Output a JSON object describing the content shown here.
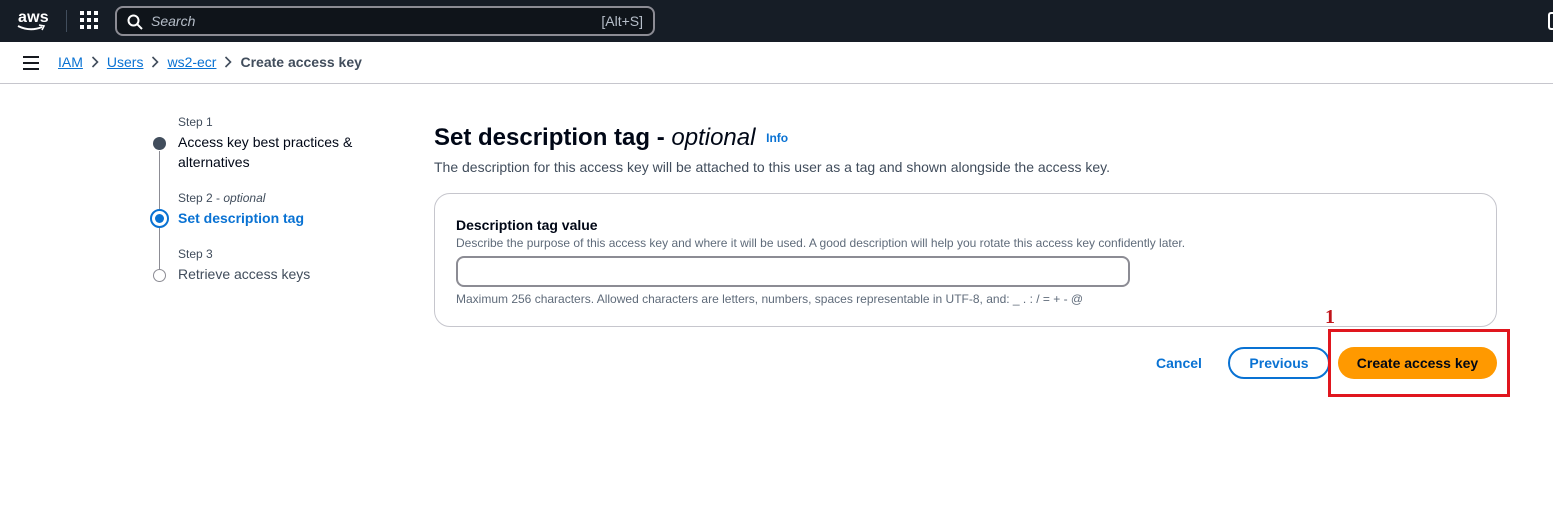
{
  "topnav": {
    "logo_text": "aws",
    "search_placeholder": "Search",
    "search_shortcut": "[Alt+S]"
  },
  "breadcrumb": {
    "items": [
      "IAM",
      "Users",
      "ws2-ecr"
    ],
    "current": "Create access key"
  },
  "steps": [
    {
      "number": "Step 1",
      "optional": "",
      "title_line1": "Access key best practices &",
      "title_line2": "alternatives",
      "state": "completed"
    },
    {
      "number": "Step 2",
      "optional": "optional",
      "title_line1": "Set description tag",
      "title_line2": "",
      "state": "active"
    },
    {
      "number": "Step 3",
      "optional": "",
      "title_line1": "Retrieve access keys",
      "title_line2": "",
      "state": "upcoming"
    }
  ],
  "main": {
    "title": "Set description tag -",
    "title_optional": "optional",
    "info_link": "Info",
    "description": "The description for this access key will be attached to this user as a tag and shown alongside the access key.",
    "field": {
      "label": "Description tag value",
      "description": "Describe the purpose of this access key and where it will be used. A good description will help you rotate this access key confidently later.",
      "value": "",
      "constraint": "Maximum 256 characters. Allowed characters are letters, numbers, spaces representable in UTF-8, and: _ . : / = + - @"
    }
  },
  "actions": {
    "cancel": "Cancel",
    "previous": "Previous",
    "create": "Create access key"
  },
  "annotation": {
    "number": "1",
    "color": "#e0161e"
  },
  "colors": {
    "nav_bg": "#161d26",
    "link": "#0972d3",
    "primary_button": "#ff9900"
  }
}
